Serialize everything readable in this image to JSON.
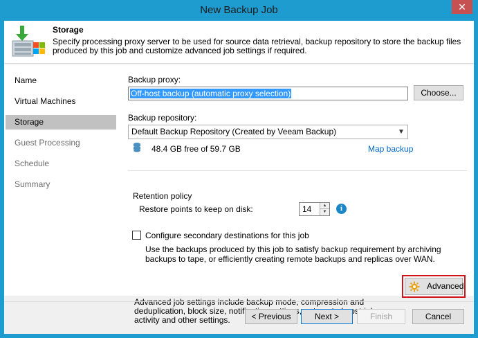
{
  "window": {
    "title": "New Backup Job",
    "close_glyph": "✕"
  },
  "header": {
    "title": "Storage",
    "description": "Specify processing proxy server to be used for source data retrieval, backup repository to store the backup files produced by this job and customize advanced job settings if required."
  },
  "sidebar": {
    "items": [
      {
        "label": "Name"
      },
      {
        "label": "Virtual Machines"
      },
      {
        "label": "Storage"
      },
      {
        "label": "Guest Processing"
      },
      {
        "label": "Schedule"
      },
      {
        "label": "Summary"
      }
    ],
    "active_item": "Storage"
  },
  "proxy": {
    "label": "Backup proxy:",
    "value": "Off-host backup (automatic proxy selection)",
    "choose_label": "Choose..."
  },
  "repository": {
    "label": "Backup repository:",
    "value": "Default Backup Repository (Created by Veeam Backup)",
    "free_space": "48.4 GB free of 59.7 GB",
    "map_link": "Map backup"
  },
  "retention": {
    "label": "Retention policy",
    "restore_points_label": "Restore points to keep on disk:",
    "restore_points_value": "14"
  },
  "secondary": {
    "checkbox_label": "Configure secondary destinations for this job",
    "checked": false,
    "description": "Use the backups produced by this job to satisfy backup requirement by archiving backups to tape, or efficiently creating remote backups and replicas over WAN."
  },
  "advanced": {
    "description": "Advanced job settings include backup mode, compression and deduplication, block size, notification settings, automated post-job activity and other settings.",
    "button_label": "Advanced"
  },
  "footer": {
    "previous_label": "< Previous",
    "next_label": "Next >",
    "finish_label": "Finish",
    "cancel_label": "Cancel"
  },
  "colors": {
    "window_frame": "#1e9ccf",
    "link": "#0066cc",
    "selection": "#3399ff",
    "highlight_box": "#d0131b"
  }
}
